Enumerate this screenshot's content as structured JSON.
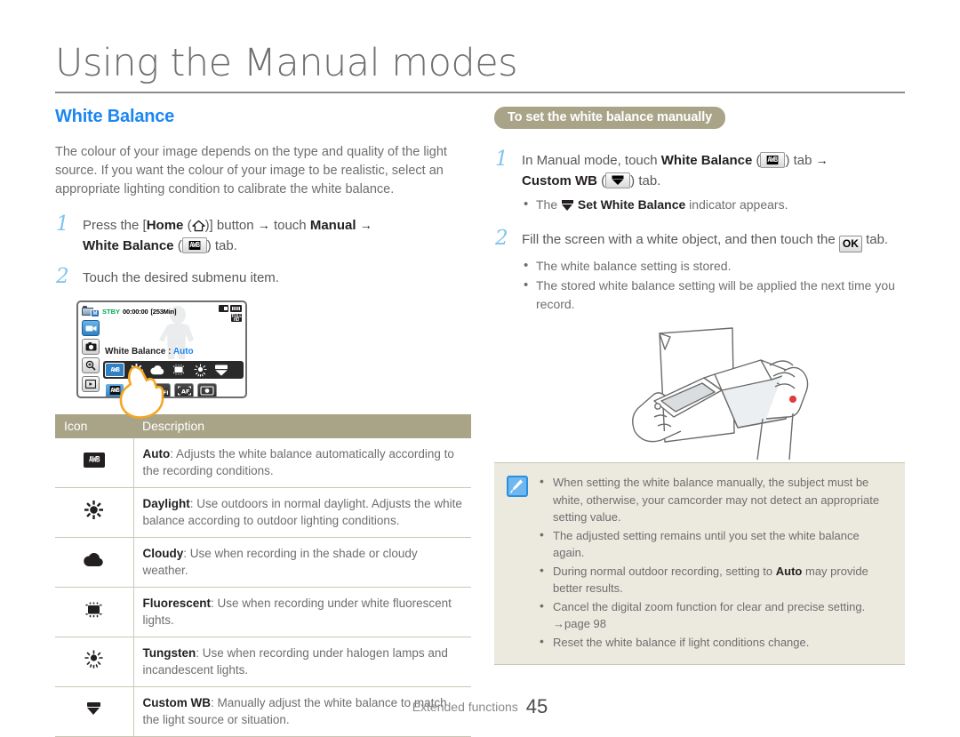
{
  "document": {
    "title": "Using the Manual modes",
    "footer_label": "Extended functions",
    "footer_page": "45"
  },
  "left": {
    "section_heading": "White Balance",
    "intro": "The colour of your image depends on the type and quality of the light source. If you want the colour of your image to be realistic, select an appropriate lighting condition to calibrate the white balance.",
    "steps": [
      {
        "num": "1",
        "part1": "Press the [",
        "home_label": "Home",
        "part2": "(",
        "part3": ")] button",
        "arrow1": "→",
        "part4": "touch",
        "manual_label": "Manual",
        "arrow2": "→",
        "wb_label": "White Balance",
        "part5": "(",
        "part6": ") tab."
      },
      {
        "num": "2",
        "text": "Touch the desired submenu item."
      }
    ],
    "lcd": {
      "mode_badge": "M",
      "status": "STBY",
      "timecode": "00:00:00",
      "remaining": "[253Min]",
      "quality_badge": "FULL HD",
      "setting_label": "White Balance :",
      "setting_value": "Auto",
      "awb_text": "AWB",
      "left_buttons": [
        "video-mode",
        "photo-mode",
        "zoom",
        "playback"
      ],
      "wb_options": [
        "AWB",
        "daylight",
        "cloudy",
        "fluorescent",
        "tungsten",
        "custom-wb"
      ],
      "bottom_options": [
        "AWB",
        "focus-off",
        "auto-focus",
        "face-detect"
      ]
    },
    "table": {
      "headers": [
        "Icon",
        "Description"
      ],
      "rows": [
        {
          "icon": "awb-icon",
          "term": "Auto",
          "desc": ": Adjusts the white balance automatically according to the recording conditions."
        },
        {
          "icon": "daylight-icon",
          "term": "Daylight",
          "desc": ": Use outdoors in normal daylight. Adjusts the white balance according to outdoor lighting conditions."
        },
        {
          "icon": "cloudy-icon",
          "term": "Cloudy",
          "desc": ": Use when recording in the shade or cloudy weather."
        },
        {
          "icon": "fluorescent-icon",
          "term": "Fluorescent",
          "desc": ": Use when recording under white fluorescent lights."
        },
        {
          "icon": "tungsten-icon",
          "term": "Tungsten",
          "desc": ": Use when recording under halogen lamps and incandescent lights."
        },
        {
          "icon": "custom-wb-icon",
          "term": "Custom WB",
          "desc": ": Manually adjust the white balance to match the light source or situation."
        }
      ]
    }
  },
  "right": {
    "badge": "To set the white balance manually",
    "step1": {
      "num": "1",
      "part1": "In Manual mode, touch",
      "wb_label": "White Balance",
      "part2": "(",
      "part3": ") tab",
      "arrow": "→",
      "custom_label": "Custom WB",
      "part4": "(",
      "part5": ") tab.",
      "bullet_pre": "The",
      "bullet_bold": "Set White Balance",
      "bullet_post": "indicator appears."
    },
    "step2": {
      "num": "2",
      "part1": "Fill the screen with a white object, and then touch the",
      "ok_label": "OK",
      "part2": "tab.",
      "bullets": [
        "The white balance setting is stored.",
        "The stored white balance setting will be applied the next time you record."
      ]
    },
    "note": {
      "items": [
        {
          "pre": "When setting the white balance manually, the subject must be white, otherwise, your camcorder may not detect an appropriate setting value.",
          "bold": "",
          "post": ""
        },
        {
          "pre": "The adjusted setting remains until you set the white balance again.",
          "bold": "",
          "post": ""
        },
        {
          "pre": "During normal outdoor recording, setting to",
          "bold": "Auto",
          "post": "may provide better results."
        },
        {
          "pre": "Cancel the digital zoom function for clear and precise setting.",
          "bold": "",
          "post": "",
          "ref": "→page 98"
        },
        {
          "pre": "Reset the white balance if light conditions change.",
          "bold": "",
          "post": ""
        }
      ]
    }
  },
  "colors": {
    "heading_blue": "#1b86f2",
    "badge_khaki": "#a9a488",
    "note_bg": "#ece9de",
    "step_number": "#7fc4ef",
    "body_gray": "#6d6e70"
  }
}
